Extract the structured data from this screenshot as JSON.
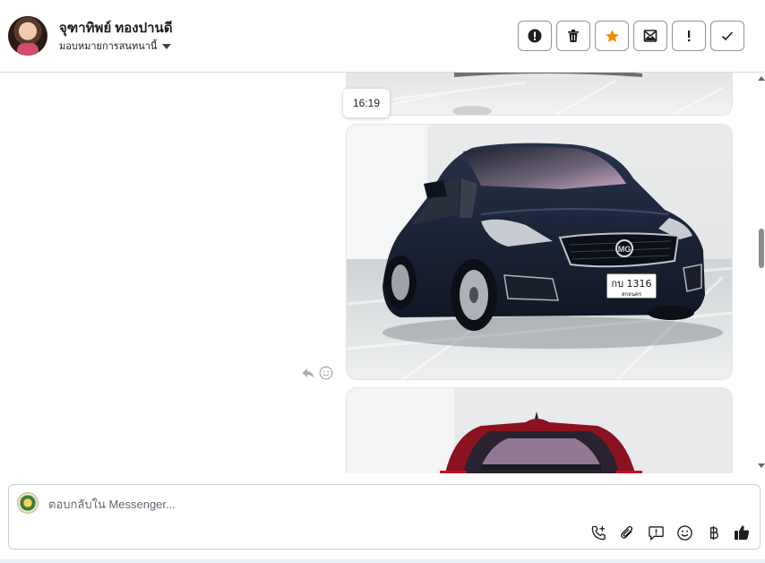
{
  "header": {
    "user_name": "จุฑาทิพย์ ทองปานดี",
    "assign_label": "มอบหมายการสนทนานี้",
    "actions": [
      {
        "name": "mark-spam-button",
        "icon": "alert-circle-icon"
      },
      {
        "name": "delete-button",
        "icon": "trash-icon"
      },
      {
        "name": "star-button",
        "icon": "star-icon"
      },
      {
        "name": "mark-unread-button",
        "icon": "envelope-open-icon"
      },
      {
        "name": "follow-up-button",
        "icon": "exclamation-icon"
      },
      {
        "name": "mark-done-button",
        "icon": "checkmark-icon"
      }
    ]
  },
  "conversation": {
    "timestamp": "16:19",
    "car_plate": {
      "number": "กบ 1316",
      "province": "สกลนคร"
    },
    "message_actions": [
      "reply-icon",
      "emoji-icon"
    ]
  },
  "composer": {
    "placeholder": "ตอบกลับใน Messenger...",
    "tools": [
      "call-add-icon",
      "paperclip-icon",
      "saved-reply-icon",
      "emoji-icon",
      "baht-icon",
      "thumbs-up-icon"
    ]
  },
  "colors": {
    "star": "#f28c00",
    "border": "#dadde1",
    "icon": "#1c1e21"
  }
}
